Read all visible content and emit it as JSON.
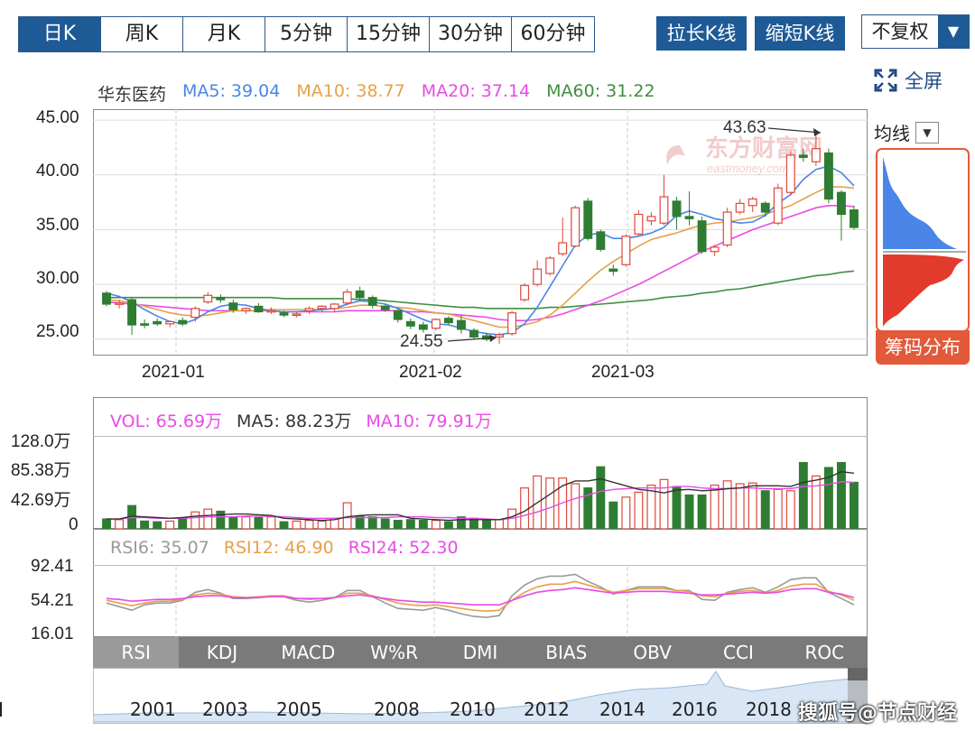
{
  "period_tabs": [
    "日K",
    "周K",
    "月K",
    "5分钟",
    "15分钟",
    "30分钟",
    "60分钟"
  ],
  "actions": {
    "stretch": "拉长K线",
    "shrink": "缩短K线",
    "fuquan": "不复权",
    "fullscreen": "全屏"
  },
  "ma_legend": {
    "name": "华东医药",
    "ma5": "MA5: 39.04",
    "ma10": "MA10: 38.77",
    "ma20": "MA20: 37.14",
    "ma60": "MA60: 31.22"
  },
  "price_axis": [
    "45.00",
    "40.00",
    "35.00",
    "30.00",
    "25.00"
  ],
  "date_axis": [
    "2021-01",
    "2021-02",
    "2021-03"
  ],
  "annotations": {
    "high": "43.63",
    "low": "24.55"
  },
  "watermark_brand": {
    "cn": "东方财富网",
    "en": "eastmoney.com"
  },
  "chip_panel": {
    "avg_label": "均线",
    "chip_button": "筹码分布"
  },
  "vol_legend": {
    "vol": "VOL: 65.69万",
    "ma5": "MA5: 88.23万",
    "ma10": "MA10: 79.91万"
  },
  "vol_axis": [
    "128.0万",
    "85.38万",
    "42.69万",
    "0"
  ],
  "rsi_legend": {
    "rsi6": "RSI6: 35.07",
    "rsi12": "RSI12: 46.90",
    "rsi24": "RSI24: 52.30"
  },
  "rsi_axis": [
    "92.41",
    "54.21",
    "16.01"
  ],
  "indicator_tabs": [
    "RSI",
    "KDJ",
    "MACD",
    "W%R",
    "DMI",
    "BIAS",
    "OBV",
    "CCI",
    "ROC"
  ],
  "years": [
    "2001",
    "2003",
    "2005",
    "2008",
    "2010",
    "2012",
    "2014",
    "2016",
    "2018"
  ],
  "watermark": "搜狐号@节点财经",
  "colors": {
    "up": "#e0463a",
    "down": "#2f7d32",
    "ma5": "#4a86e8",
    "ma10": "#e8a048",
    "ma20": "#e84ae8",
    "ma60": "#3f8f3f",
    "accent": "#1e5a96"
  },
  "chart_data": {
    "type": "candlestick",
    "price_range": [
      23.5,
      46
    ],
    "volume_range": [
      0,
      128
    ],
    "rsi_range": [
      16.01,
      92.41
    ],
    "candles": [
      {
        "o": 29.2,
        "h": 29.4,
        "l": 28.0,
        "c": 28.2
      },
      {
        "o": 28.2,
        "h": 28.6,
        "l": 27.8,
        "c": 28.3
      },
      {
        "o": 28.6,
        "h": 28.8,
        "l": 25.4,
        "c": 26.3
      },
      {
        "o": 26.4,
        "h": 26.8,
        "l": 26.0,
        "c": 26.3
      },
      {
        "o": 26.6,
        "h": 26.9,
        "l": 26.2,
        "c": 26.4
      },
      {
        "o": 26.4,
        "h": 26.7,
        "l": 26.1,
        "c": 26.6
      },
      {
        "o": 26.7,
        "h": 27.0,
        "l": 26.2,
        "c": 26.4
      },
      {
        "o": 27.0,
        "h": 28.0,
        "l": 26.6,
        "c": 27.8
      },
      {
        "o": 28.4,
        "h": 29.3,
        "l": 28.2,
        "c": 29.0
      },
      {
        "o": 28.8,
        "h": 29.1,
        "l": 28.3,
        "c": 28.6
      },
      {
        "o": 28.3,
        "h": 28.6,
        "l": 27.4,
        "c": 27.7
      },
      {
        "o": 27.6,
        "h": 27.9,
        "l": 27.3,
        "c": 27.8
      },
      {
        "o": 28.0,
        "h": 28.3,
        "l": 27.4,
        "c": 27.5
      },
      {
        "o": 27.6,
        "h": 27.9,
        "l": 27.3,
        "c": 27.6
      },
      {
        "o": 27.4,
        "h": 27.6,
        "l": 27.0,
        "c": 27.2
      },
      {
        "o": 27.2,
        "h": 27.5,
        "l": 27.0,
        "c": 27.3
      },
      {
        "o": 27.6,
        "h": 28.0,
        "l": 27.3,
        "c": 27.8
      },
      {
        "o": 27.8,
        "h": 28.1,
        "l": 27.5,
        "c": 28.0
      },
      {
        "o": 27.8,
        "h": 28.3,
        "l": 27.5,
        "c": 28.2
      },
      {
        "o": 28.3,
        "h": 29.6,
        "l": 28.1,
        "c": 29.3
      },
      {
        "o": 29.4,
        "h": 29.8,
        "l": 28.6,
        "c": 28.8
      },
      {
        "o": 28.8,
        "h": 29.0,
        "l": 27.8,
        "c": 28.1
      },
      {
        "o": 28.0,
        "h": 28.2,
        "l": 27.5,
        "c": 27.7
      },
      {
        "o": 27.6,
        "h": 27.8,
        "l": 26.5,
        "c": 26.8
      },
      {
        "o": 26.6,
        "h": 26.9,
        "l": 25.9,
        "c": 26.2
      },
      {
        "o": 26.3,
        "h": 26.6,
        "l": 25.6,
        "c": 25.9
      },
      {
        "o": 26.0,
        "h": 26.9,
        "l": 25.8,
        "c": 26.8
      },
      {
        "o": 26.9,
        "h": 27.1,
        "l": 26.3,
        "c": 26.5
      },
      {
        "o": 26.7,
        "h": 27.2,
        "l": 25.5,
        "c": 25.9
      },
      {
        "o": 25.8,
        "h": 26.0,
        "l": 25.0,
        "c": 25.2
      },
      {
        "o": 25.3,
        "h": 25.6,
        "l": 24.8,
        "c": 25.0
      },
      {
        "o": 25.2,
        "h": 25.6,
        "l": 24.55,
        "c": 25.4
      },
      {
        "o": 25.5,
        "h": 27.6,
        "l": 25.3,
        "c": 27.4
      },
      {
        "o": 28.6,
        "h": 30.1,
        "l": 28.4,
        "c": 29.9
      },
      {
        "o": 30.0,
        "h": 32.2,
        "l": 29.8,
        "c": 31.4
      },
      {
        "o": 31.0,
        "h": 32.6,
        "l": 30.8,
        "c": 32.4
      },
      {
        "o": 32.8,
        "h": 36.1,
        "l": 32.6,
        "c": 33.8
      },
      {
        "o": 33.5,
        "h": 37.2,
        "l": 33.4,
        "c": 37.0
      },
      {
        "o": 37.6,
        "h": 37.9,
        "l": 34.0,
        "c": 34.2
      },
      {
        "o": 34.8,
        "h": 35.0,
        "l": 33.0,
        "c": 33.2
      },
      {
        "o": 31.4,
        "h": 31.8,
        "l": 30.8,
        "c": 31.2
      },
      {
        "o": 31.8,
        "h": 34.6,
        "l": 31.6,
        "c": 34.4
      },
      {
        "o": 34.6,
        "h": 36.8,
        "l": 34.4,
        "c": 36.4
      },
      {
        "o": 35.8,
        "h": 36.6,
        "l": 35.4,
        "c": 36.2
      },
      {
        "o": 35.6,
        "h": 40.0,
        "l": 35.4,
        "c": 38.0
      },
      {
        "o": 37.6,
        "h": 38.0,
        "l": 35.0,
        "c": 36.2
      },
      {
        "o": 36.2,
        "h": 38.5,
        "l": 35.4,
        "c": 36.0
      },
      {
        "o": 35.8,
        "h": 36.2,
        "l": 32.8,
        "c": 33.0
      },
      {
        "o": 33.0,
        "h": 33.6,
        "l": 32.6,
        "c": 33.4
      },
      {
        "o": 33.6,
        "h": 37.0,
        "l": 33.4,
        "c": 36.6
      },
      {
        "o": 36.6,
        "h": 37.8,
        "l": 36.4,
        "c": 37.4
      },
      {
        "o": 37.2,
        "h": 38.0,
        "l": 36.6,
        "c": 37.8
      },
      {
        "o": 37.4,
        "h": 37.6,
        "l": 36.2,
        "c": 36.6
      },
      {
        "o": 35.6,
        "h": 39.2,
        "l": 35.4,
        "c": 38.8
      },
      {
        "o": 38.4,
        "h": 42.2,
        "l": 38.2,
        "c": 41.8
      },
      {
        "o": 41.8,
        "h": 42.4,
        "l": 41.2,
        "c": 41.6
      },
      {
        "o": 41.2,
        "h": 43.63,
        "l": 40.8,
        "c": 42.4
      },
      {
        "o": 42.0,
        "h": 42.4,
        "l": 37.4,
        "c": 37.8
      },
      {
        "o": 38.4,
        "h": 38.6,
        "l": 34.0,
        "c": 36.4
      },
      {
        "o": 36.8,
        "h": 37.2,
        "l": 35.0,
        "c": 35.2
      }
    ],
    "ma5": [
      29.2,
      28.9,
      28.4,
      27.7,
      27.1,
      26.6,
      26.4,
      26.8,
      27.5,
      28.0,
      28.2,
      28.1,
      27.8,
      27.6,
      27.5,
      27.5,
      27.6,
      27.7,
      27.8,
      28.2,
      28.5,
      28.4,
      28.2,
      27.8,
      27.3,
      26.8,
      26.4,
      26.3,
      26.0,
      25.7,
      25.5,
      25.4,
      25.6,
      26.4,
      27.9,
      29.8,
      31.7,
      33.6,
      34.5,
      34.7,
      34.2,
      34.2,
      34.4,
      34.7,
      35.2,
      36.3,
      36.7,
      36.4,
      36.0,
      35.8,
      35.6,
      35.7,
      36.3,
      37.4,
      38.2,
      39.6,
      40.5,
      40.8,
      40.2,
      39.0
    ],
    "ma10": [
      28.6,
      28.5,
      28.3,
      28.0,
      27.7,
      27.4,
      27.2,
      27.1,
      27.2,
      27.4,
      27.6,
      27.6,
      27.6,
      27.7,
      27.7,
      27.7,
      27.7,
      27.7,
      27.8,
      27.9,
      28.1,
      28.1,
      28.0,
      27.9,
      27.8,
      27.6,
      27.4,
      27.3,
      27.0,
      26.7,
      26.4,
      26.1,
      26.1,
      26.3,
      26.6,
      27.2,
      28.1,
      29.2,
      30.3,
      31.3,
      32.1,
      32.8,
      33.5,
      34.1,
      34.4,
      34.7,
      35.1,
      35.4,
      35.6,
      35.7,
      35.9,
      36.1,
      36.4,
      36.8,
      37.2,
      37.8,
      38.4,
      38.9,
      38.9,
      38.8
    ],
    "ma20": [
      28.4,
      28.3,
      28.2,
      28.1,
      28.0,
      27.9,
      27.8,
      27.7,
      27.6,
      27.6,
      27.6,
      27.6,
      27.6,
      27.6,
      27.5,
      27.5,
      27.5,
      27.5,
      27.5,
      27.6,
      27.6,
      27.6,
      27.6,
      27.6,
      27.5,
      27.5,
      27.4,
      27.3,
      27.2,
      27.1,
      27.0,
      26.8,
      26.7,
      26.7,
      26.8,
      27.0,
      27.3,
      27.7,
      28.1,
      28.5,
      29.0,
      29.5,
      30.0,
      30.6,
      31.2,
      31.8,
      32.4,
      33.0,
      33.5,
      34.0,
      34.5,
      35.0,
      35.4,
      35.8,
      36.2,
      36.6,
      37.0,
      37.2,
      37.2,
      37.1
    ],
    "ma60": [
      28.8,
      28.8,
      28.8,
      28.8,
      28.8,
      28.8,
      28.8,
      28.8,
      28.8,
      28.8,
      28.8,
      28.8,
      28.8,
      28.8,
      28.7,
      28.7,
      28.7,
      28.7,
      28.7,
      28.7,
      28.6,
      28.6,
      28.5,
      28.4,
      28.3,
      28.2,
      28.1,
      28.0,
      27.9,
      27.9,
      27.8,
      27.8,
      27.8,
      27.8,
      27.8,
      27.9,
      27.9,
      28.0,
      28.1,
      28.2,
      28.3,
      28.4,
      28.5,
      28.6,
      28.8,
      28.9,
      29.0,
      29.2,
      29.3,
      29.5,
      29.6,
      29.8,
      30.0,
      30.2,
      30.4,
      30.6,
      30.8,
      30.9,
      31.1,
      31.22
    ],
    "volume": [
      14,
      13,
      33,
      11,
      10,
      11,
      14,
      24,
      28,
      25,
      17,
      17,
      16,
      17,
      10,
      11,
      12,
      11,
      15,
      37,
      18,
      17,
      14,
      12,
      13,
      12,
      12,
      10,
      17,
      15,
      12,
      13,
      28,
      58,
      75,
      72,
      72,
      64,
      58,
      88,
      38,
      45,
      52,
      62,
      70,
      60,
      48,
      48,
      62,
      68,
      64,
      65,
      54,
      56,
      54,
      94,
      75,
      87,
      94,
      66
    ],
    "vol_ma5": [
      14,
      14,
      18,
      17,
      16,
      15,
      16,
      18,
      19,
      20,
      21,
      21,
      20,
      19,
      15,
      14,
      13,
      12,
      13,
      17,
      19,
      20,
      20,
      20,
      15,
      14,
      13,
      12,
      13,
      13,
      13,
      13,
      17,
      25,
      37,
      49,
      61,
      68,
      68,
      71,
      66,
      61,
      56,
      54,
      51,
      55,
      56,
      54,
      55,
      57,
      58,
      61,
      61,
      61,
      60,
      66,
      69,
      73,
      81,
      79
    ],
    "vol_ma10": [
      14,
      14,
      16,
      16,
      15,
      15,
      15,
      16,
      17,
      17,
      17,
      18,
      18,
      18,
      17,
      16,
      15,
      15,
      15,
      16,
      16,
      16,
      16,
      17,
      17,
      17,
      16,
      16,
      15,
      15,
      14,
      13,
      15,
      19,
      24,
      30,
      37,
      43,
      48,
      53,
      56,
      57,
      58,
      58,
      58,
      60,
      60,
      58,
      57,
      57,
      58,
      58,
      57,
      57,
      57,
      60,
      61,
      63,
      67,
      66
    ],
    "rsi6": [
      52,
      48,
      44,
      50,
      52,
      52,
      55,
      64,
      67,
      63,
      57,
      57,
      58,
      60,
      59,
      55,
      53,
      55,
      58,
      66,
      66,
      59,
      52,
      46,
      45,
      44,
      47,
      44,
      40,
      37,
      36,
      38,
      60,
      72,
      79,
      82,
      82,
      84,
      76,
      70,
      62,
      66,
      70,
      70,
      70,
      66,
      66,
      56,
      55,
      64,
      67,
      69,
      64,
      70,
      78,
      80,
      80,
      64,
      57,
      50
    ],
    "rsi12": [
      55,
      52,
      49,
      52,
      54,
      54,
      56,
      61,
      63,
      62,
      59,
      58,
      59,
      60,
      60,
      57,
      56,
      57,
      58,
      63,
      63,
      60,
      56,
      52,
      50,
      49,
      50,
      48,
      46,
      44,
      43,
      44,
      55,
      64,
      70,
      73,
      73,
      76,
      72,
      68,
      64,
      66,
      68,
      68,
      68,
      66,
      65,
      60,
      59,
      63,
      65,
      66,
      63,
      66,
      71,
      73,
      73,
      65,
      61,
      55
    ],
    "rsi24": [
      57,
      56,
      54,
      55,
      56,
      56,
      57,
      59,
      60,
      60,
      58,
      58,
      58,
      59,
      59,
      57,
      57,
      57,
      58,
      60,
      61,
      59,
      57,
      55,
      54,
      53,
      53,
      52,
      51,
      50,
      50,
      50,
      55,
      60,
      64,
      66,
      67,
      69,
      67,
      65,
      63,
      64,
      65,
      65,
      65,
      64,
      63,
      61,
      61,
      62,
      63,
      64,
      63,
      64,
      67,
      68,
      68,
      64,
      62,
      58
    ]
  }
}
